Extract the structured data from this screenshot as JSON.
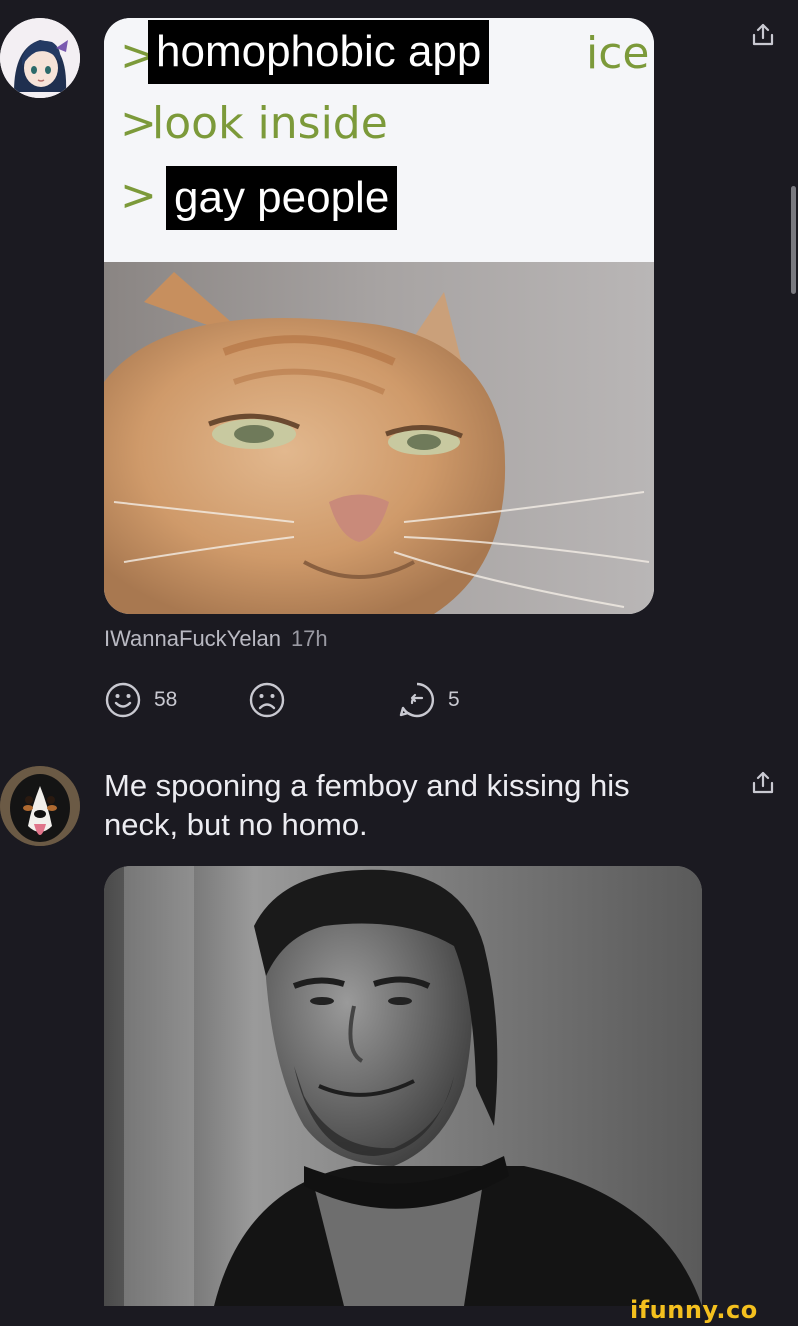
{
  "comments": [
    {
      "meme": {
        "lines": [
          {
            "prefix": ">",
            "blackout": "homophobic app",
            "trailing": "ice"
          },
          {
            "prefix": ">",
            "text": "look inside"
          },
          {
            "prefix": ">",
            "blackout": "gay people"
          }
        ]
      },
      "author": "IWannaFuckYelan",
      "time": "17h",
      "reactions": {
        "smile_count": "58",
        "reply_count": "5"
      }
    },
    {
      "text": "Me spooning a femboy and kissing his neck, but no homo."
    }
  ],
  "watermark": "ifunny.co",
  "colors": {
    "background": "#1b1a21",
    "greentext": "#7c9a3a",
    "watermark": "#f4c01e"
  },
  "icons": [
    "share-icon",
    "smile-icon",
    "frown-icon",
    "reply-icon"
  ]
}
